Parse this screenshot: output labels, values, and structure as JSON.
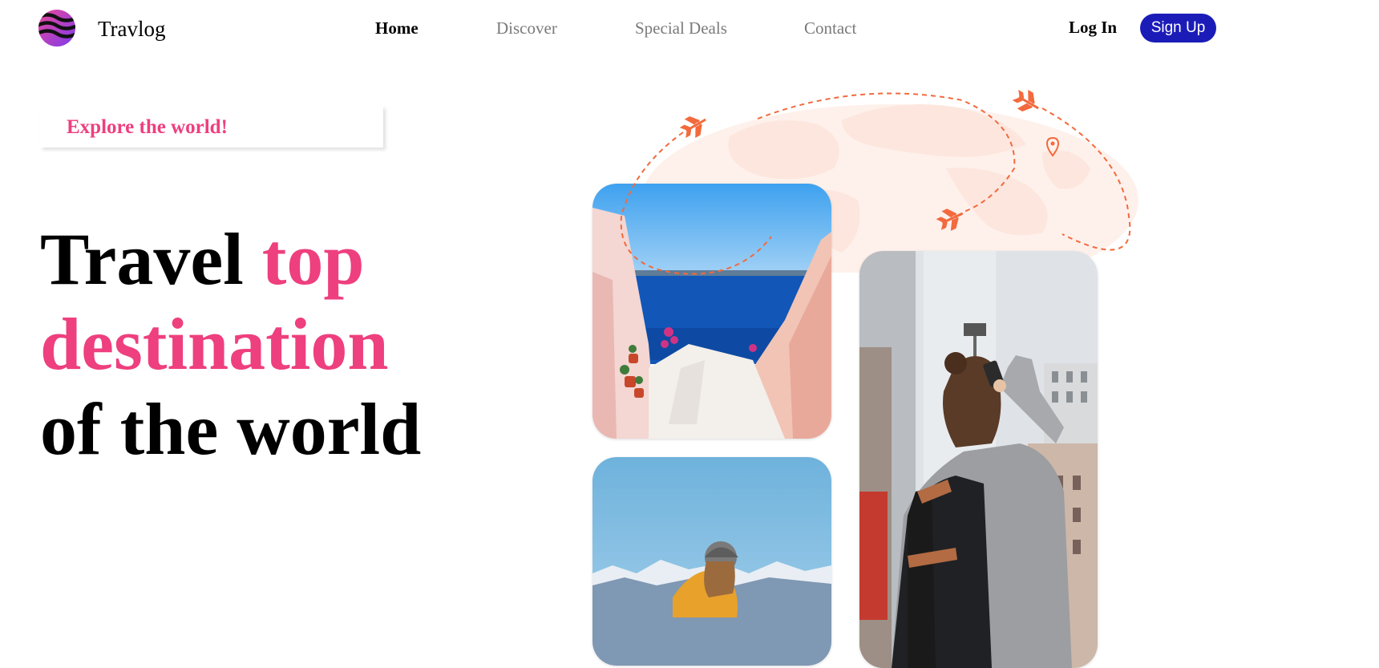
{
  "brand": {
    "name": "Travlog"
  },
  "nav": {
    "items": [
      {
        "label": "Home",
        "active": true
      },
      {
        "label": "Discover",
        "active": false
      },
      {
        "label": "Special Deals",
        "active": false
      },
      {
        "label": "Contact",
        "active": false
      }
    ]
  },
  "auth": {
    "login_label": "Log In",
    "signup_label": "Sign Up"
  },
  "hero": {
    "tagline": "Explore the world!",
    "headline": {
      "part1": "Travel ",
      "part2": "top destination",
      "part3": "of the world"
    }
  },
  "colors": {
    "accent_pink": "#ee3f7e",
    "signup_blue": "#1b1cb8",
    "route_orange": "#f26a3d",
    "map_peach": "#fde6dd"
  },
  "icons": [
    "logo-icon",
    "plane-icon",
    "location-pin-icon"
  ]
}
